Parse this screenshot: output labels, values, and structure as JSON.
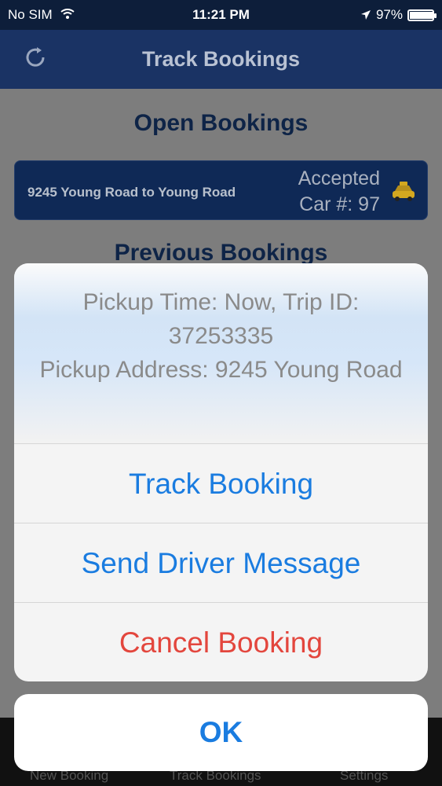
{
  "status_bar": {
    "carrier": "No SIM",
    "time": "11:21 PM",
    "battery": "97%",
    "battery_level": 0.97
  },
  "nav": {
    "title": "Track Bookings",
    "refresh_icon": "refresh-icon"
  },
  "open_section": {
    "title": "Open Bookings"
  },
  "open_bookings": [
    {
      "route": "9245 Young Road to Young Road",
      "status": "Accepted",
      "car": "Car #: 97",
      "icon": "taxi-icon"
    }
  ],
  "previous_section": {
    "title": "Previous Bookings"
  },
  "tab_bar": {
    "items": [
      "New Booking",
      "Track Bookings",
      "Settings"
    ]
  },
  "action_sheet": {
    "line1": "Pickup Time: Now, Trip ID: 37253335",
    "line2": "Pickup Address: 9245 Young Road",
    "buttons": [
      "Track Booking",
      "Send Driver Message",
      "Cancel Booking"
    ],
    "ok": "OK"
  },
  "colors": {
    "accent": "#1a7ce0",
    "destructive": "#e3463d",
    "nav": "#1a3364"
  }
}
